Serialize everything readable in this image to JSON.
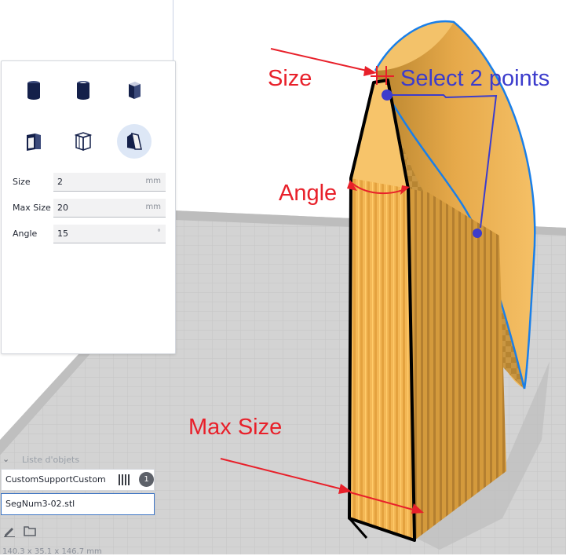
{
  "tool_panel": {
    "fields": [
      {
        "label": "Size",
        "value": "2",
        "unit": "mm"
      },
      {
        "label": "Max Size",
        "value": "20",
        "unit": "mm"
      },
      {
        "label": "Angle",
        "value": "15",
        "unit": "°"
      }
    ],
    "icons": [
      "cylinder-support-icon",
      "tube-support-icon",
      "cube-support-icon",
      "abutment-support-icon",
      "freeform-support-icon",
      "custom-support-icon"
    ]
  },
  "objects_panel": {
    "title": "Liste d'objets",
    "items": [
      {
        "name": "CustomSupportCustom",
        "count": "1"
      },
      {
        "name": "SegNum3-02.stl"
      }
    ]
  },
  "dimensions": "140.3 x 35.1 x 146.7 mm",
  "annotations": {
    "size": "Size",
    "select": "Select 2 points",
    "angle": "Angle",
    "max_size": "Max Size"
  },
  "colors": {
    "annotation_red": "#e8202a",
    "annotation_blue": "#3c3ccc",
    "model_orange": "#f2b24e",
    "selection_blue": "#1a7fe8",
    "build_plate": "#d5d5d5"
  }
}
